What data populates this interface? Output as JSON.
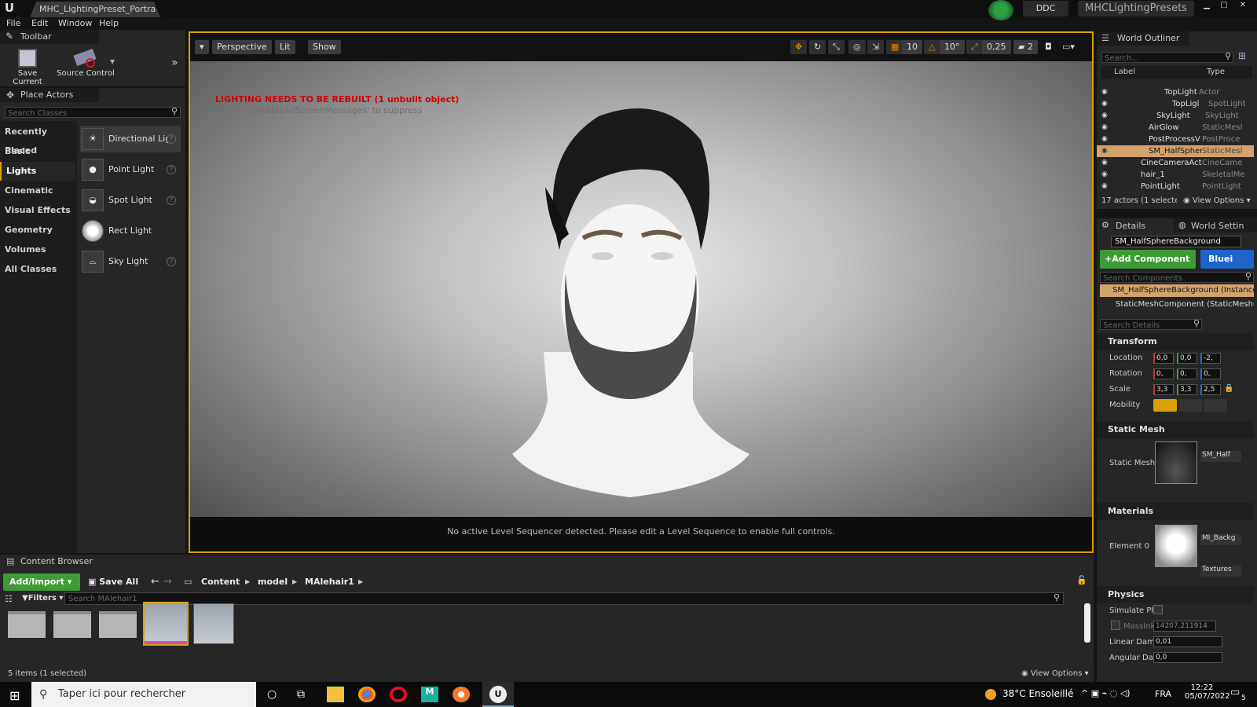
{
  "title_bar": {
    "doc_tab": "MHC_LightingPreset_Portra•",
    "ddc_label": "DDC",
    "project_name": "MHCLightingPresets"
  },
  "menu": [
    "File",
    "Edit",
    "Window",
    "Help"
  ],
  "toolbar": {
    "title": "Toolbar",
    "save_current": "Save Current",
    "source_control": "Source Control"
  },
  "place_actors": {
    "title": "Place Actors",
    "search_placeholder": "Search Classes",
    "categories": [
      "Recently Placed",
      "Basic",
      "Lights",
      "Cinematic",
      "Visual Effects",
      "Geometry",
      "Volumes",
      "All Classes"
    ],
    "actors": [
      "Directional Ligl",
      "Point Light",
      "Spot Light",
      "Rect Light",
      "Sky Light"
    ]
  },
  "viewport": {
    "perspective": "Perspective",
    "lit": "Lit",
    "show": "Show",
    "warning": "LIGHTING NEEDS TO BE REBUILT (1 unbuilt object)",
    "suppress": "'DisableAllScreenMessages' to suppress",
    "grid": "10",
    "angle": "10°",
    "scale": "0,25",
    "cam_speed": "2",
    "footer": "No active Level Sequencer detected. Please edit a Level Sequence to enable full controls."
  },
  "outliner": {
    "title": "World Outliner",
    "search_placeholder": "Search...",
    "col_label": "Label",
    "col_type": "Type",
    "rows": [
      {
        "label": "TopLight",
        "type": "Actor"
      },
      {
        "label": "TopLigl",
        "type": "SpotLight"
      },
      {
        "label": "SkyLight",
        "type": "SkyLight"
      },
      {
        "label": "AirGlow",
        "type": "StaticMesl"
      },
      {
        "label": "PostProcessV",
        "type": "PostProce"
      },
      {
        "label": "SM_HalfSpher",
        "type": "StaticMesl"
      },
      {
        "label": "CineCameraActc",
        "type": "CineCame"
      },
      {
        "label": "hair_1",
        "type": "SkeletalMe"
      },
      {
        "label": "PointLight",
        "type": "PointLight"
      }
    ],
    "status": "17 actors (1 selecte",
    "view_options": "View Options"
  },
  "details": {
    "tab_details": "Details",
    "tab_world": "World Settin",
    "object_name": "SM_HalfSphereBackground",
    "add_component": "+Add Component",
    "blueprint": "Bluei",
    "search_components": "Search Components",
    "instance": "SM_HalfSphereBackground (Instance)",
    "component": "StaticMeshComponent (StaticMeshC",
    "search_details": "Search Details",
    "transform": "Transform",
    "location_label": "Location",
    "location": [
      "0,0",
      "0,0",
      "-2,"
    ],
    "rotation_label": "Rotation",
    "rotation": [
      "0,",
      "0,",
      "0,"
    ],
    "scale_label": "Scale",
    "scale": [
      "3,3",
      "3,3",
      "2,5"
    ],
    "mobility_label": "Mobility",
    "static_mesh_section": "Static Mesh",
    "static_mesh_label": "Static Mesh",
    "static_mesh_value": "SM_Half",
    "materials_section": "Materials",
    "element_label": "Element 0",
    "material_value": "MI_Backg",
    "textures": "Textures",
    "physics_section": "Physics",
    "simulate": "Simulate Ph",
    "mass_label": "MassInk",
    "mass_value": "14207,211914",
    "linear_damp_label": "Linear Damp",
    "linear_damp": "0,01",
    "angular_damp_label": "Angular Dam",
    "angular_damp": "0,0"
  },
  "content_browser": {
    "title": "Content Browser",
    "add_import": "Add/Import",
    "save_all": "Save All",
    "path": [
      "Content",
      "model",
      "MAlehair1"
    ],
    "filters": "Filters",
    "search_placeholder": "Search MAlehair1",
    "status": "5 items (1 selected)",
    "view_options": "View Options"
  },
  "taskbar": {
    "search": "Taper ici pour rechercher",
    "weather": "38°C Ensoleillé",
    "lang": "FRA",
    "time": "12:22",
    "date": "05/07/2022",
    "notif_count": "5"
  },
  "colors": {
    "accent_orange": "#d9a000",
    "green_btn": "#3d9b35",
    "blue_btn": "#1f64c8",
    "selected_row": "#d2a36b"
  }
}
